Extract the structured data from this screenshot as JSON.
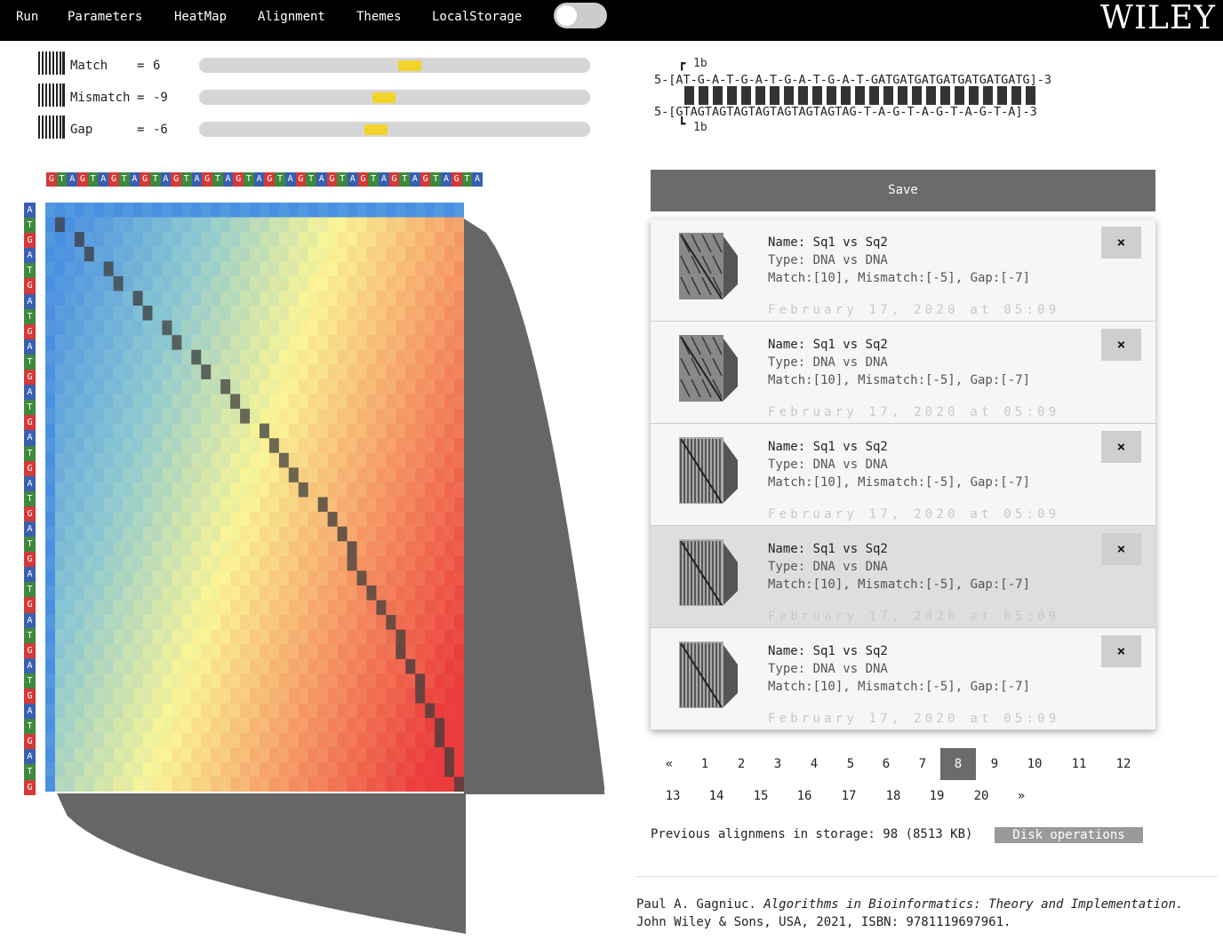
{
  "nav": {
    "items": [
      "Run",
      "Parameters",
      "HeatMap",
      "Alignment",
      "Themes",
      "LocalStorage"
    ],
    "brand": "WILEY"
  },
  "parameters": [
    {
      "label": "Match",
      "eq": "=",
      "value": "6",
      "level": 0.54
    },
    {
      "label": "Mismatch",
      "eq": "=",
      "value": "-9",
      "level": 0.47
    },
    {
      "label": "Gap",
      "eq": "=",
      "value": "-6",
      "level": 0.45
    }
  ],
  "sequences": {
    "top": "GTAGTAGTAGTAGTAGTAGTAGTAGTAGTAGTAGTAGTAGTA",
    "left": "ATGATGATGATGATGATGATGATGATGATGATGATGATG",
    "colors": {
      "A": "#3a5fb0",
      "T": "#3d8a3d",
      "G": "#d23a3a",
      "C": "#c8a020"
    }
  },
  "alignment": {
    "marker_top": "1b",
    "line1": "5-[AT-G-A-T-G-A-T-G-A-T-G-A-T-GATGATGATGATGATGATGATG]-3",
    "line2": "5-[GTAGTAGTAGTAGTAGTAGTAGTAG-T-A-G-T-A-G-T-A-G-T-A]-3",
    "marker_bottom": "1b"
  },
  "save_label": "Save",
  "saved": [
    {
      "name": "Name: Sq1 vs Sq2",
      "type": "Type: DNA vs DNA",
      "params": "Match:[10], Mismatch:[-5], Gap:[-7]",
      "date": "February 17, 2020 at 05:09",
      "close": "×"
    },
    {
      "name": "Name: Sq1 vs Sq2",
      "type": "Type: DNA vs DNA",
      "params": "Match:[10], Mismatch:[-5], Gap:[-7]",
      "date": "February 17, 2020 at 05:09",
      "close": "×"
    },
    {
      "name": "Name: Sq1 vs Sq2",
      "type": "Type: DNA vs DNA",
      "params": "Match:[10], Mismatch:[-5], Gap:[-7]",
      "date": "February 17, 2020 at 05:09",
      "close": "×"
    },
    {
      "name": "Name: Sq1 vs Sq2",
      "type": "Type: DNA vs DNA",
      "params": "Match:[10], Mismatch:[-5], Gap:[-7]",
      "date": "February 17, 2020 at 05:09",
      "close": "×"
    },
    {
      "name": "Name: Sq1 vs Sq2",
      "type": "Type: DNA vs DNA",
      "params": "Match:[10], Mismatch:[-5], Gap:[-7]",
      "date": "February 17, 2020 at 05:09",
      "close": "×"
    }
  ],
  "pagination": {
    "row1": [
      "«",
      "1",
      "2",
      "3",
      "4",
      "5",
      "6",
      "7",
      "8",
      "9",
      "10",
      "11",
      "12"
    ],
    "row2": [
      "13",
      "14",
      "15",
      "16",
      "17",
      "18",
      "19",
      "20",
      "»"
    ],
    "current": "8"
  },
  "storage_text": "Previous alignmens in storage: 98 (8513 KB)",
  "disk_button": "Disk operations",
  "citation": {
    "author": "Paul A. Gagniuc. ",
    "title": "Algorithms in Bioinformatics: Theory and Implementation.",
    "rest": "John Wiley & Sons, USA, 2021, ISBN: 9781119697961."
  }
}
